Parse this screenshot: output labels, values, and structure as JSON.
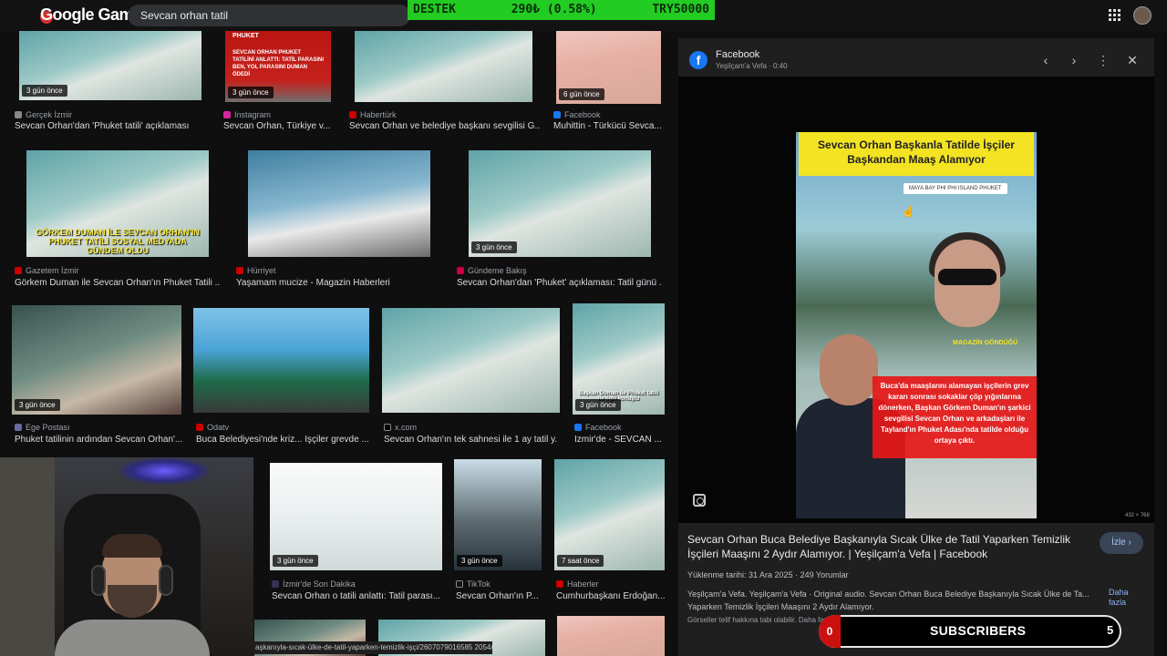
{
  "header": {
    "logo_text": "Google Game",
    "search_value": "Sevcan orhan tatil",
    "ticker": {
      "label": "DESTEK",
      "value": "290₺ (0.58%)",
      "goal": "TRY50000"
    }
  },
  "results": [
    {
      "badge": "3 gün önce",
      "source": "Gerçek İzmir",
      "caption": "Sevcan Orhan'dan 'Phuket tatili' açıklaması"
    },
    {
      "badge": "3 gün önce",
      "tag": "PHUKET",
      "headline": "SEVCAN ORHAN PHUKET TATİLİNİ ANLATTI: TATİL PARASINI BEN, YOL PARASINI DUMAN ÖDEDİ",
      "source": "Instagram",
      "caption": "Sevcan Orhan, Türkiye v..."
    },
    {
      "source": "Habertürk",
      "caption": "Sevcan Orhan ve belediye başkanı sevgilisi G..."
    },
    {
      "badge": "6 gün önce",
      "source": "Facebook",
      "caption": "Muhittin - Türkücü Sevca..."
    },
    {
      "overlay": "GÖRKEM DUMAN İLE SEVCAN ORHAN'IN PHUKET TATİLİ SOSYAL MEDYADA GÜNDEM OLDU",
      "source": "Gazetem İzmir",
      "caption": "Görkem Duman ile Sevcan Orhan'ın Phuket Tatili ..."
    },
    {
      "source": "Hürriyet",
      "caption": "Yaşamam mucize - Magazin Haberleri"
    },
    {
      "badge": "3 gün önce",
      "source": "Gündeme Bakış",
      "caption": "Sevcan Orhan'dan 'Phuket' açıklaması: Tatil günü ..."
    },
    {
      "badge": "3 gün önce",
      "source": "Ege Postası",
      "caption": "Phuket tatilinin ardından Sevcan Orhan'..."
    },
    {
      "source": "Odatv",
      "caption": "Buca Belediyesi'nde kriz... İşçiler grevde ..."
    },
    {
      "source": "x.com",
      "caption": "Sevcan Orhan'ın tek sahnesi ile 1 ay tatil y..."
    },
    {
      "badge": "3 gün önce",
      "overlay": "Başkan Duman ile Phuket tatili ile ilgili konuştu",
      "source": "Facebook",
      "caption": "İzmir'de - SEVCAN ..."
    },
    {
      "badge": "3 gün önce",
      "source": "İzmir'de Son Dakika",
      "caption": "Sevcan Orhan o tatili anlattı: Tatil parası..."
    },
    {
      "badge": "3 gün önce",
      "source": "TikTok",
      "caption": "Sevcan Orhan'ın P..."
    },
    {
      "badge": "7 saat önce",
      "source": "Haberler",
      "caption": "Cumhurbaşkanı Erdoğan..."
    }
  ],
  "panel": {
    "source_name": "Facebook",
    "source_sub": "Yeşilçam'a Vefa · 0:40",
    "image_title": "Sevcan Orhan Başkanla Tatilde İşçiler Başkandan Maaş Alamıyor",
    "location": "MAYA BAY PHI PHI ISLAND PHUKET",
    "mag_tag": "MAGAZİN GÖNDÜĞÜ",
    "red_text": "Buca'da maaşlarını alamayan işçilerin grev kararı sonrası sokaklar çöp yığınlarına dönerken, Başkan Görkem Duman'ın şarkici sevgilisi Sevcan Orhan ve arkadaşları ile Tayland'ın Phuket Adası'nda tatilde olduğu ortaya çıktı.",
    "image_size": "432 × 768",
    "video_title": "Sevcan Orhan Buca Belediye Başkanıyla Sıcak Ülke de Tatil Yaparken Temizlik İşçileri Maaşını 2 Aydır Alamıyor. | Yeşilçam'a Vefa | Facebook",
    "watch_label": "İzle ›",
    "meta": "Yüklenme tarihi: 31 Ara 2025 · 249 Yorumlar",
    "description": "Yeşilçam'a Vefa. Yeşilçam'a Vefa · Original audio. Sevcan Orhan Buca Belediye Başkanıyla Sıcak Ülke de Ta... Yaparken Temizlik İşçileri Maaşını 2 Aydır Alamıyor.",
    "more_label": "Daha fazla",
    "notice": "Görseller telif hakkına tabi olabilir. Daha fazla bilgi"
  },
  "overlay": {
    "subscribers_label": "SUBSCRIBERS",
    "subscribers_left": "0",
    "subscribers_right": "5",
    "status_url": "aşkanıyla-sıcak-ülke-de-tatil-yaparken-temizlik-işçi/2607079016585 2054/"
  },
  "colors": {
    "ticker_bg": "#22cc22",
    "facebook_blue": "#1877f2",
    "accent_link": "#8ab4f8",
    "sub_red": "#cc1010"
  }
}
